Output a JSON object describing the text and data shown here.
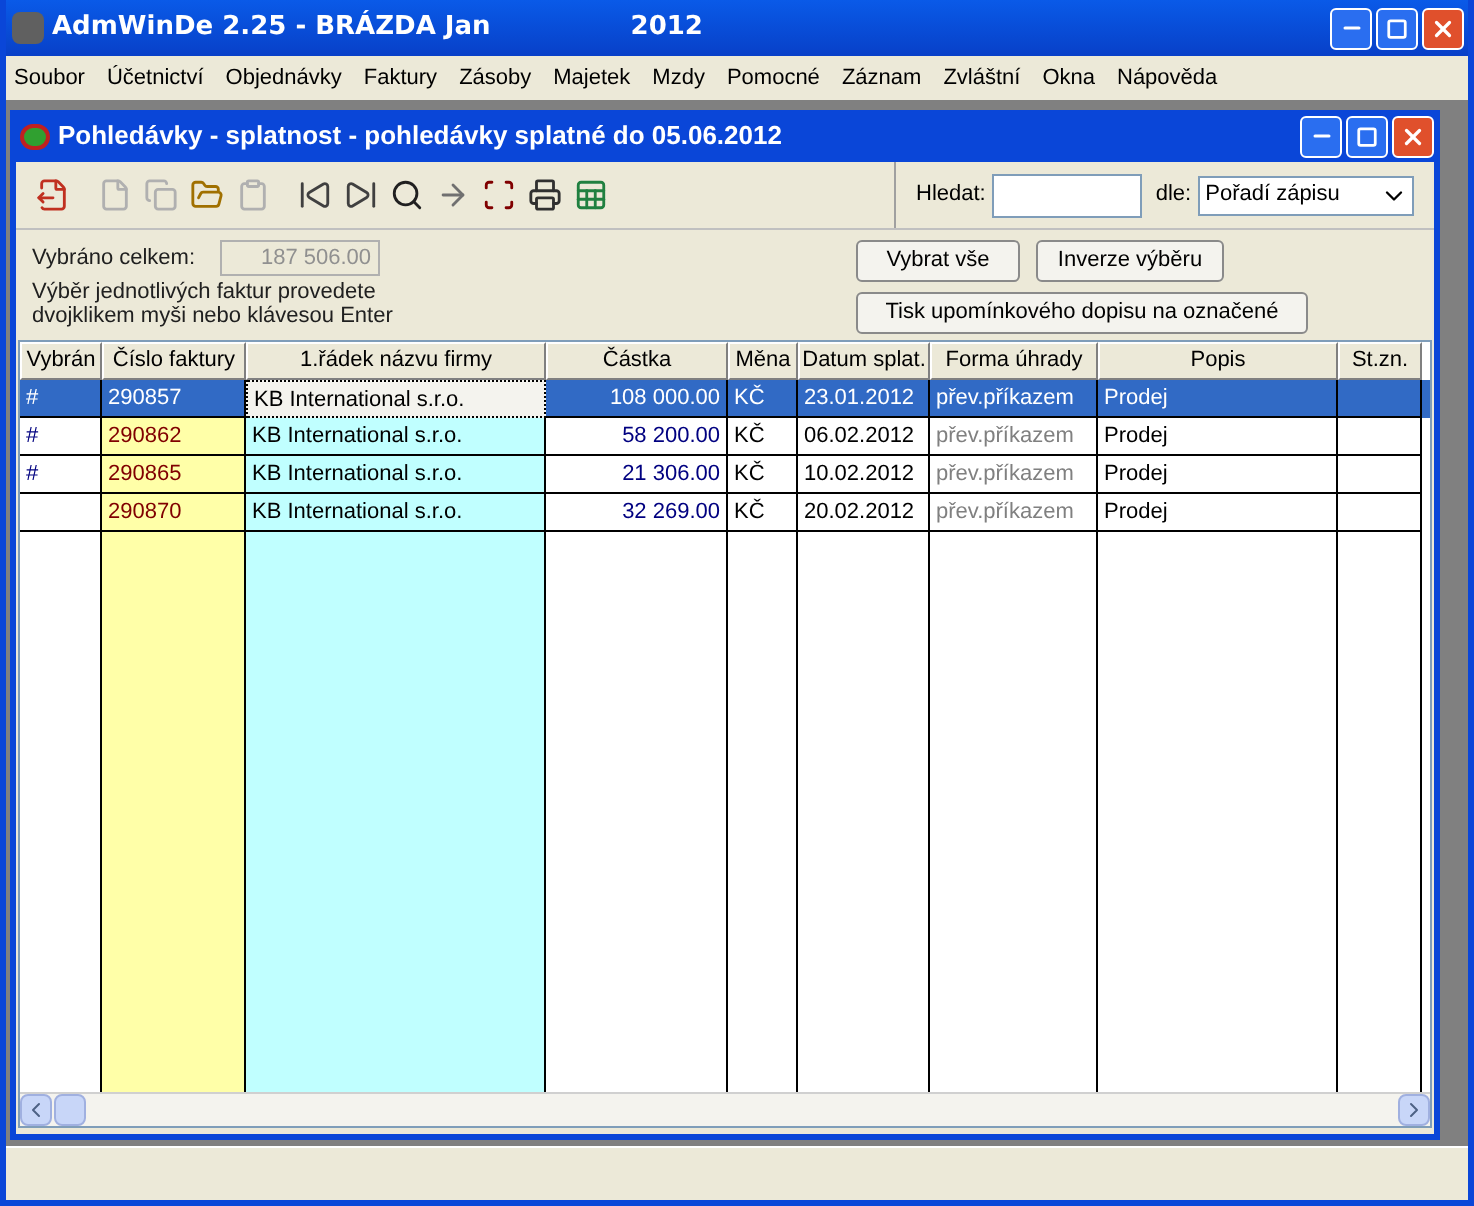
{
  "window": {
    "title": "AdmWinDe 2.25 - BRÁZDA Jan",
    "year": "2012"
  },
  "menu": [
    "Soubor",
    "Účetnictví",
    "Objednávky",
    "Faktury",
    "Zásoby",
    "Majetek",
    "Mzdy",
    "Pomocné",
    "Záznam",
    "Zvláštní",
    "Okna",
    "Nápověda"
  ],
  "child_window": {
    "title": "Pohledávky - splatnost - pohledávky splatné do 05.06.2012"
  },
  "toolbar": [
    {
      "disabled": false
    },
    {
      "disabled": true
    },
    {
      "disabled": true
    },
    {
      "disabled": false
    },
    {
      "disabled": true
    },
    {
      "disabled": false
    },
    {
      "disabled": false
    },
    {
      "disabled": false
    },
    {
      "disabled": false
    },
    {
      "disabled": false
    },
    {
      "disabled": false
    },
    {
      "disabled": false
    }
  ],
  "search": {
    "label": "Hledat:",
    "by_label": "dle:",
    "by_value": "Pořadí zápisu"
  },
  "summary": {
    "label": "Vybráno celkem:",
    "value": "187 506.00",
    "hint": "Výběr jednotlivých faktur provedete",
    "hint2": "dvojklikem myši nebo klávesou Enter"
  },
  "buttons": [
    "Vybrat vše",
    "Inverze výběru",
    "Tisk upomínkového dopisu na označené"
  ],
  "table": {
    "columns": [
      "Vybrán",
      "Číslo faktury",
      "1.řádek názvu firmy",
      "Částka",
      "Měna",
      "Datum splat.",
      "Forma úhrady",
      "Popis",
      "St.zn."
    ],
    "rows": [
      {
        "selected": true,
        "cells": [
          "#",
          "290857",
          "KB International s.r.o.",
          "108 000.00",
          "KČ",
          "23.01.2012",
          "přev.příkazem",
          "Prodej",
          ""
        ]
      },
      {
        "selected": false,
        "cells": [
          "#",
          "290862",
          "KB International s.r.o.",
          "58 200.00",
          "KČ",
          "06.02.2012",
          "přev.příkazem",
          "Prodej",
          ""
        ]
      },
      {
        "selected": false,
        "cells": [
          "#",
          "290865",
          "KB International s.r.o.",
          "21 306.00",
          "KČ",
          "10.02.2012",
          "přev.příkazem",
          "Prodej",
          ""
        ]
      },
      {
        "selected": false,
        "cells": [
          "",
          "290870",
          "KB International s.r.o.",
          "32 269.00",
          "KČ",
          "20.02.2012",
          "přev.příkazem",
          "Prodej",
          ""
        ]
      }
    ]
  }
}
